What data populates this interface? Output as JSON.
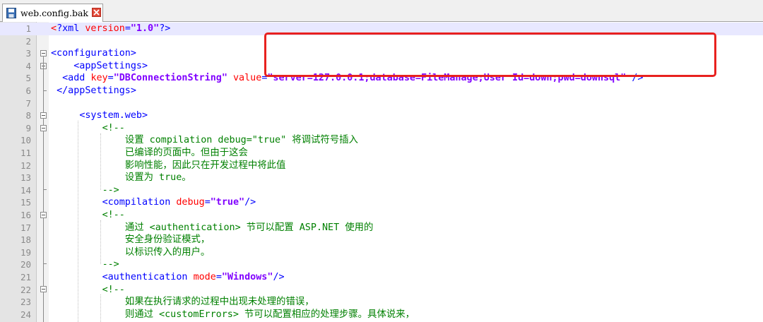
{
  "tab": {
    "title": "web.config.bak",
    "icon": "save-disk-icon",
    "close_icon": "close-icon"
  },
  "colors": {
    "tag": "#0000ff",
    "attribute": "#ff0000",
    "value": "#8000ff",
    "comment": "#008000",
    "highlight_box": "#e8211f"
  },
  "lines": [
    {
      "n": "1",
      "parts": [
        {
          "t": "<",
          "c": "c-caret"
        },
        {
          "t": "?xml ",
          "c": "c-pi"
        },
        {
          "t": "version",
          "c": "c-piv"
        },
        {
          "t": "=",
          "c": "c-pi"
        },
        {
          "t": "\"1.0\"",
          "c": "c-val"
        },
        {
          "t": "?>",
          "c": "c-pi"
        }
      ]
    },
    {
      "n": "2",
      "parts": []
    },
    {
      "n": "3",
      "parts": [
        {
          "t": "<configuration>",
          "c": "c-tag"
        }
      ]
    },
    {
      "n": "4",
      "parts": [
        {
          "t": "    ",
          "c": ""
        },
        {
          "t": "<appSettings>",
          "c": "c-tag"
        }
      ]
    },
    {
      "n": "5",
      "parts": [
        {
          "t": "  ",
          "c": ""
        },
        {
          "t": "<add ",
          "c": "c-tag"
        },
        {
          "t": "key",
          "c": "c-attr"
        },
        {
          "t": "=",
          "c": "c-tag"
        },
        {
          "t": "\"DBConnectionString\"",
          "c": "c-val"
        },
        {
          "t": " ",
          "c": ""
        },
        {
          "t": "value",
          "c": "c-attr"
        },
        {
          "t": "=",
          "c": "c-tag"
        },
        {
          "t": "\"server=127.0.0.1;database=FileManage;User Id=down;pwd=downsql\"",
          "c": "c-val"
        },
        {
          "t": " />",
          "c": "c-tag"
        }
      ]
    },
    {
      "n": "6",
      "parts": [
        {
          "t": " ",
          "c": ""
        },
        {
          "t": "</appSettings>",
          "c": "c-tag"
        }
      ]
    },
    {
      "n": "7",
      "parts": []
    },
    {
      "n": "8",
      "parts": [
        {
          "t": "     ",
          "c": ""
        },
        {
          "t": "<system.web>",
          "c": "c-tag"
        }
      ]
    },
    {
      "n": "9",
      "parts": [
        {
          "t": "         ",
          "c": ""
        },
        {
          "t": "<!--",
          "c": "c-com"
        }
      ]
    },
    {
      "n": "10",
      "parts": [
        {
          "t": "             ",
          "c": ""
        },
        {
          "t": "设置 compilation debug=\"true\" 将调试符号插入",
          "c": "c-com"
        }
      ]
    },
    {
      "n": "11",
      "parts": [
        {
          "t": "             ",
          "c": ""
        },
        {
          "t": "已编译的页面中。但由于这会",
          "c": "c-com"
        }
      ]
    },
    {
      "n": "12",
      "parts": [
        {
          "t": "             ",
          "c": ""
        },
        {
          "t": "影响性能，因此只在开发过程中将此值",
          "c": "c-com"
        }
      ]
    },
    {
      "n": "13",
      "parts": [
        {
          "t": "             ",
          "c": ""
        },
        {
          "t": "设置为 true。",
          "c": "c-com"
        }
      ]
    },
    {
      "n": "14",
      "parts": [
        {
          "t": "         ",
          "c": ""
        },
        {
          "t": "-->",
          "c": "c-com"
        }
      ]
    },
    {
      "n": "15",
      "parts": [
        {
          "t": "         ",
          "c": ""
        },
        {
          "t": "<compilation ",
          "c": "c-tag"
        },
        {
          "t": "debug",
          "c": "c-attr"
        },
        {
          "t": "=",
          "c": "c-tag"
        },
        {
          "t": "\"true\"",
          "c": "c-val"
        },
        {
          "t": "/>",
          "c": "c-tag"
        }
      ]
    },
    {
      "n": "16",
      "parts": [
        {
          "t": "         ",
          "c": ""
        },
        {
          "t": "<!--",
          "c": "c-com"
        }
      ]
    },
    {
      "n": "17",
      "parts": [
        {
          "t": "             ",
          "c": ""
        },
        {
          "t": "通过 <authentication> 节可以配置 ASP.NET 使用的",
          "c": "c-com"
        }
      ]
    },
    {
      "n": "18",
      "parts": [
        {
          "t": "             ",
          "c": ""
        },
        {
          "t": "安全身份验证模式，",
          "c": "c-com"
        }
      ]
    },
    {
      "n": "19",
      "parts": [
        {
          "t": "             ",
          "c": ""
        },
        {
          "t": "以标识传入的用户。",
          "c": "c-com"
        }
      ]
    },
    {
      "n": "20",
      "parts": [
        {
          "t": "         ",
          "c": ""
        },
        {
          "t": "-->",
          "c": "c-com"
        }
      ]
    },
    {
      "n": "21",
      "parts": [
        {
          "t": "         ",
          "c": ""
        },
        {
          "t": "<authentication ",
          "c": "c-tag"
        },
        {
          "t": "mode",
          "c": "c-attr"
        },
        {
          "t": "=",
          "c": "c-tag"
        },
        {
          "t": "\"Windows\"",
          "c": "c-val"
        },
        {
          "t": "/>",
          "c": "c-tag"
        }
      ]
    },
    {
      "n": "22",
      "parts": [
        {
          "t": "         ",
          "c": ""
        },
        {
          "t": "<!--",
          "c": "c-com"
        }
      ]
    },
    {
      "n": "23",
      "parts": [
        {
          "t": "             ",
          "c": ""
        },
        {
          "t": "如果在执行请求的过程中出现未处理的错误，",
          "c": "c-com"
        }
      ]
    },
    {
      "n": "24",
      "parts": [
        {
          "t": "             ",
          "c": ""
        },
        {
          "t": "则通过 <customErrors> 节可以配置相应的处理步骤。具体说来，",
          "c": "c-com"
        }
      ]
    }
  ]
}
